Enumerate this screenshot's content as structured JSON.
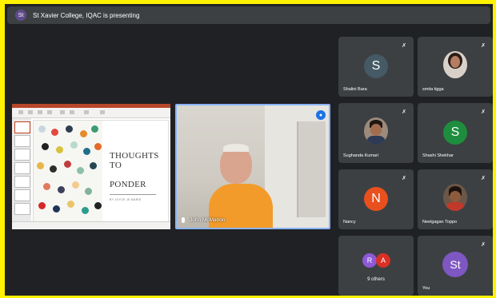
{
  "banner": {
    "avatar_initial": "St",
    "text": "St Xavier College, IQAC is presenting"
  },
  "presentation": {
    "slide_title_line1": "THOUGHTS TO",
    "slide_title_line2": "PONDER",
    "slide_author": "BY JOYCE JE MARIE"
  },
  "speaker": {
    "name": "John McMahon"
  },
  "participants": [
    {
      "name": "Shalini Bara",
      "initial": "S",
      "color": "#455a64",
      "muted": true
    },
    {
      "name": "smita tigga",
      "initial": "",
      "color": "#7b5a3e",
      "muted": true,
      "photo": true
    },
    {
      "name": "Sughanda Kumari",
      "initial": "",
      "color": "#6a4b3a",
      "muted": true,
      "photo": true
    },
    {
      "name": "Shashi Shekhar",
      "initial": "S",
      "color": "#1e8e3e",
      "muted": true
    },
    {
      "name": "Nancy",
      "initial": "N",
      "color": "#e8501e",
      "muted": true
    },
    {
      "name": "Neelgagan Toppo",
      "initial": "",
      "color": "#5a4032",
      "muted": true,
      "photo": true
    }
  ],
  "others": {
    "label": "9 others",
    "avatars": [
      {
        "initial": "R",
        "color": "#8e59d6"
      },
      {
        "initial": "A",
        "color": "#d93025"
      }
    ]
  },
  "self": {
    "name": "You",
    "initial": "St",
    "color": "#7e57c2"
  }
}
